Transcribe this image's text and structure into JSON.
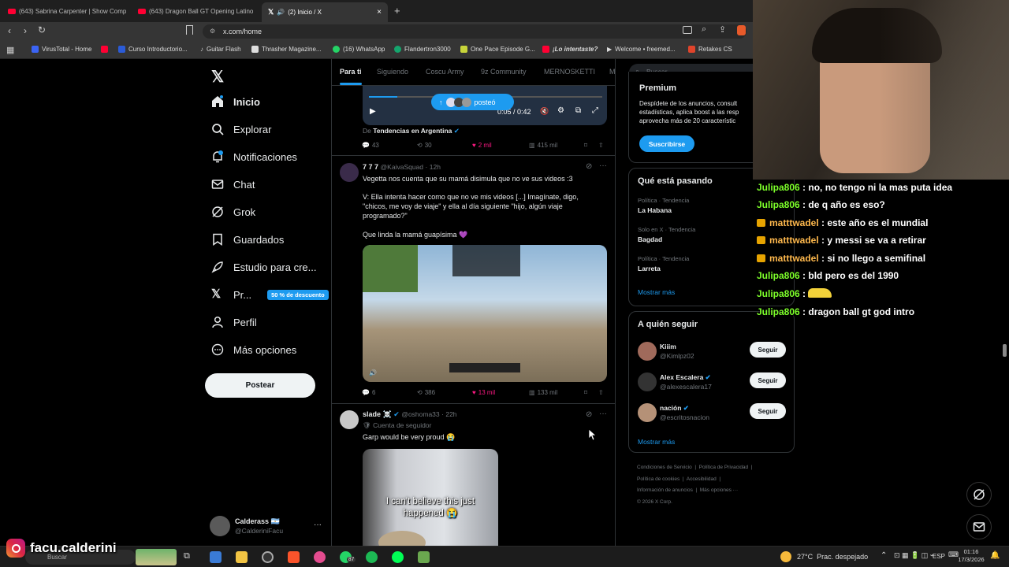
{
  "browser": {
    "tabs": [
      {
        "title": "(643) Sabrina Carpenter | Show Comp"
      },
      {
        "title": "(643) Dragon Ball GT Opening Latino"
      },
      {
        "title": "(2) Inicio / X"
      }
    ],
    "url": "x.com/home",
    "bookmarks": [
      "VirusTotal - Home",
      "Curso Introductorio...",
      "Guitar Flash",
      "Thrasher Magazine...",
      "(16) WhatsApp",
      "Flandertron3000",
      "One Pace Episode G...",
      "¡Lo intentaste?",
      "Welcome • freemed...",
      "Retakes CS"
    ]
  },
  "sidebar": {
    "items": [
      {
        "label": "Inicio"
      },
      {
        "label": "Explorar"
      },
      {
        "label": "Notificaciones"
      },
      {
        "label": "Chat"
      },
      {
        "label": "Grok"
      },
      {
        "label": "Guardados"
      },
      {
        "label": "Estudio para cre..."
      },
      {
        "label": "Pr..."
      },
      {
        "label": "Perfil"
      },
      {
        "label": "Más opciones"
      }
    ],
    "premium_badge": "50 % de descuento",
    "post_button": "Postear",
    "account": {
      "name": "Calderass 🇦🇷",
      "handle": "@CalderiniFacu"
    }
  },
  "feed": {
    "tabs": [
      "Para ti",
      "Siguiendo",
      "Coscu Army",
      "9z Community",
      "MERNOSKETTI",
      "M"
    ],
    "video_time": "0:05 / 0:42",
    "posted_pill": "posteó",
    "tweet0": {
      "source_prefix": "De",
      "source": "Tendencias en Argentina",
      "replies": "43",
      "reposts": "30",
      "likes": "2 mil",
      "views": "415 mil"
    },
    "tweet1": {
      "name": "7 7 7",
      "handle": "@KaivaSquad",
      "time": "· 12h",
      "text1": "Vegetta nos cuenta que su mamá disimula que no ve sus videos :3",
      "text2": "V: Ella intenta hacer como que no ve mis videos [...] Imagínate, digo, \"chicos, me voy de viaje\" y ella al día siguiente \"hijo, algún viaje programado?\"",
      "text3": "Que linda la mamá guapísima 💜",
      "replies": "6",
      "reposts": "386",
      "likes": "13 mil",
      "views": "133 mil"
    },
    "tweet2": {
      "name": "slade ☠️",
      "handle": "@oshoma33",
      "time": "· 22h",
      "follower_note": "Cuenta de seguidor",
      "text": "Garp would be very proud 😭",
      "media_caption": "I can't believe this just happened 😭"
    }
  },
  "right": {
    "search_placeholder": "Buscar",
    "premium": {
      "title": "Premium",
      "text": "Despídete de los anuncios, consult estadísticas, aplica boost a las resp aprovecha más de 20 característic",
      "button": "Suscribirse"
    },
    "trends": {
      "title": "Qué está pasando",
      "items": [
        {
          "context": "Política · Tendencia",
          "name": "La Habana"
        },
        {
          "context": "Solo en X · Tendencia",
          "name": "Bagdad"
        },
        {
          "context": "Política · Tendencia",
          "name": "Larreta"
        }
      ],
      "more": "Mostrar más"
    },
    "who_to_follow": {
      "title": "A quién seguir",
      "items": [
        {
          "name": "Kiiim",
          "handle": "@Kimlpz02",
          "button": "Seguir"
        },
        {
          "name": "Alex Escalera",
          "handle": "@alexescalera17",
          "button": "Seguir"
        },
        {
          "name": "nación",
          "handle": "@escritosnacion",
          "button": "Seguir"
        }
      ],
      "more": "Mostrar más"
    },
    "footer": {
      "line1a": "Condiciones de Servicio",
      "line1b": "Política de Privacidad",
      "line2a": "Política de cookies",
      "line2b": "Accesibilidad",
      "line3a": "Información de anuncios",
      "line3b": "Más opciones ···",
      "copyright": "© 2026 X Corp."
    }
  },
  "overlay": {
    "chat": [
      {
        "user": "Julipa806",
        "msg": ": no, no tengo ni la mas puta idea",
        "gold": false
      },
      {
        "user": "Julipa806",
        "msg": ": de q año es eso?",
        "gold": false
      },
      {
        "user": "matttwadel",
        "msg": ": este año es el mundial",
        "gold": true
      },
      {
        "user": "matttwadel",
        "msg": ": y messi se va a retirar",
        "gold": true
      },
      {
        "user": "matttwadel",
        "msg": ": si no llego a semifinal",
        "gold": true
      },
      {
        "user": "Julipa806",
        "msg": ": bld pero es del 1990",
        "gold": false
      },
      {
        "user": "Julipa806",
        "msg": ":",
        "gold": false
      },
      {
        "user": "Julipa806",
        "msg": ": dragon ball gt god intro",
        "gold": false
      }
    ],
    "streamer_name": "facu.calderini"
  },
  "taskbar": {
    "search": "Buscar",
    "whatsapp_count": "87",
    "weather": "27°C  Prac. despejado",
    "lang": "ESP",
    "time": "01:16",
    "date": "17/3/2026"
  }
}
